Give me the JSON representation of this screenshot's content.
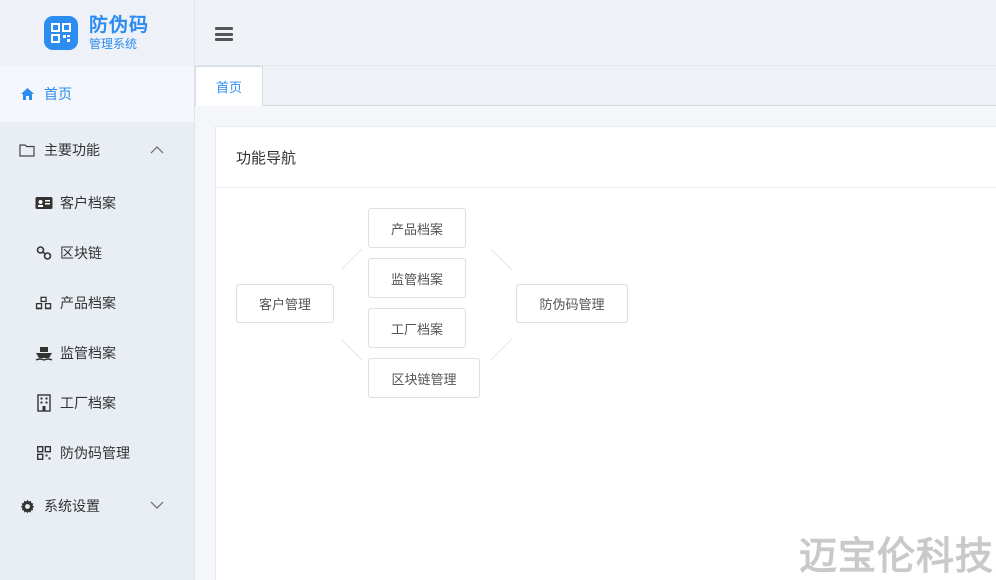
{
  "logo": {
    "title": "防伪码",
    "subtitle": "管理系统"
  },
  "sidebar": {
    "home": {
      "label": "首页",
      "icon": "home-icon"
    },
    "groups": [
      {
        "label": "主要功能",
        "icon": "folder-icon",
        "expanded": true,
        "items": [
          {
            "label": "客户档案",
            "icon": "id-card-icon"
          },
          {
            "label": "区块链",
            "icon": "link-icon"
          },
          {
            "label": "产品档案",
            "icon": "cubes-icon"
          },
          {
            "label": "监管档案",
            "icon": "ship-icon"
          },
          {
            "label": "工厂档案",
            "icon": "building-icon"
          },
          {
            "label": "防伪码管理",
            "icon": "qrcode-icon"
          }
        ]
      },
      {
        "label": "系统设置",
        "icon": "gear-icon",
        "expanded": false
      }
    ]
  },
  "tabs": [
    {
      "label": "首页",
      "active": true
    }
  ],
  "card": {
    "title": "功能导航",
    "nodes": {
      "customer": "客户管理",
      "product": "产品档案",
      "supervision": "监管档案",
      "factory": "工厂档案",
      "blockchain": "区块链管理",
      "anticounterfeit": "防伪码管理"
    }
  },
  "watermark": "迈宝伦科技",
  "colors": {
    "accent": "#2d8cf0",
    "sidebar_bg": "#e9eef5"
  }
}
